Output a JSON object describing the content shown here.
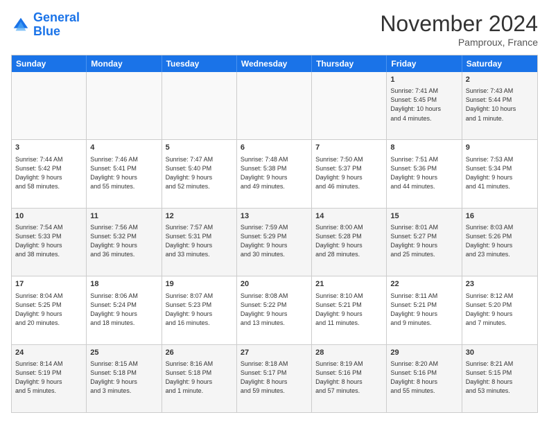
{
  "logo": {
    "line1": "General",
    "line2": "Blue"
  },
  "header": {
    "month": "November 2024",
    "location": "Pamproux, France"
  },
  "weekdays": [
    "Sunday",
    "Monday",
    "Tuesday",
    "Wednesday",
    "Thursday",
    "Friday",
    "Saturday"
  ],
  "rows": [
    [
      {
        "day": "",
        "info": "",
        "empty": true
      },
      {
        "day": "",
        "info": "",
        "empty": true
      },
      {
        "day": "",
        "info": "",
        "empty": true
      },
      {
        "day": "",
        "info": "",
        "empty": true
      },
      {
        "day": "",
        "info": "",
        "empty": true
      },
      {
        "day": "1",
        "info": "Sunrise: 7:41 AM\nSunset: 5:45 PM\nDaylight: 10 hours\nand 4 minutes.",
        "empty": false
      },
      {
        "day": "2",
        "info": "Sunrise: 7:43 AM\nSunset: 5:44 PM\nDaylight: 10 hours\nand 1 minute.",
        "empty": false
      }
    ],
    [
      {
        "day": "3",
        "info": "Sunrise: 7:44 AM\nSunset: 5:42 PM\nDaylight: 9 hours\nand 58 minutes.",
        "empty": false
      },
      {
        "day": "4",
        "info": "Sunrise: 7:46 AM\nSunset: 5:41 PM\nDaylight: 9 hours\nand 55 minutes.",
        "empty": false
      },
      {
        "day": "5",
        "info": "Sunrise: 7:47 AM\nSunset: 5:40 PM\nDaylight: 9 hours\nand 52 minutes.",
        "empty": false
      },
      {
        "day": "6",
        "info": "Sunrise: 7:48 AM\nSunset: 5:38 PM\nDaylight: 9 hours\nand 49 minutes.",
        "empty": false
      },
      {
        "day": "7",
        "info": "Sunrise: 7:50 AM\nSunset: 5:37 PM\nDaylight: 9 hours\nand 46 minutes.",
        "empty": false
      },
      {
        "day": "8",
        "info": "Sunrise: 7:51 AM\nSunset: 5:36 PM\nDaylight: 9 hours\nand 44 minutes.",
        "empty": false
      },
      {
        "day": "9",
        "info": "Sunrise: 7:53 AM\nSunset: 5:34 PM\nDaylight: 9 hours\nand 41 minutes.",
        "empty": false
      }
    ],
    [
      {
        "day": "10",
        "info": "Sunrise: 7:54 AM\nSunset: 5:33 PM\nDaylight: 9 hours\nand 38 minutes.",
        "empty": false
      },
      {
        "day": "11",
        "info": "Sunrise: 7:56 AM\nSunset: 5:32 PM\nDaylight: 9 hours\nand 36 minutes.",
        "empty": false
      },
      {
        "day": "12",
        "info": "Sunrise: 7:57 AM\nSunset: 5:31 PM\nDaylight: 9 hours\nand 33 minutes.",
        "empty": false
      },
      {
        "day": "13",
        "info": "Sunrise: 7:59 AM\nSunset: 5:29 PM\nDaylight: 9 hours\nand 30 minutes.",
        "empty": false
      },
      {
        "day": "14",
        "info": "Sunrise: 8:00 AM\nSunset: 5:28 PM\nDaylight: 9 hours\nand 28 minutes.",
        "empty": false
      },
      {
        "day": "15",
        "info": "Sunrise: 8:01 AM\nSunset: 5:27 PM\nDaylight: 9 hours\nand 25 minutes.",
        "empty": false
      },
      {
        "day": "16",
        "info": "Sunrise: 8:03 AM\nSunset: 5:26 PM\nDaylight: 9 hours\nand 23 minutes.",
        "empty": false
      }
    ],
    [
      {
        "day": "17",
        "info": "Sunrise: 8:04 AM\nSunset: 5:25 PM\nDaylight: 9 hours\nand 20 minutes.",
        "empty": false
      },
      {
        "day": "18",
        "info": "Sunrise: 8:06 AM\nSunset: 5:24 PM\nDaylight: 9 hours\nand 18 minutes.",
        "empty": false
      },
      {
        "day": "19",
        "info": "Sunrise: 8:07 AM\nSunset: 5:23 PM\nDaylight: 9 hours\nand 16 minutes.",
        "empty": false
      },
      {
        "day": "20",
        "info": "Sunrise: 8:08 AM\nSunset: 5:22 PM\nDaylight: 9 hours\nand 13 minutes.",
        "empty": false
      },
      {
        "day": "21",
        "info": "Sunrise: 8:10 AM\nSunset: 5:21 PM\nDaylight: 9 hours\nand 11 minutes.",
        "empty": false
      },
      {
        "day": "22",
        "info": "Sunrise: 8:11 AM\nSunset: 5:21 PM\nDaylight: 9 hours\nand 9 minutes.",
        "empty": false
      },
      {
        "day": "23",
        "info": "Sunrise: 8:12 AM\nSunset: 5:20 PM\nDaylight: 9 hours\nand 7 minutes.",
        "empty": false
      }
    ],
    [
      {
        "day": "24",
        "info": "Sunrise: 8:14 AM\nSunset: 5:19 PM\nDaylight: 9 hours\nand 5 minutes.",
        "empty": false
      },
      {
        "day": "25",
        "info": "Sunrise: 8:15 AM\nSunset: 5:18 PM\nDaylight: 9 hours\nand 3 minutes.",
        "empty": false
      },
      {
        "day": "26",
        "info": "Sunrise: 8:16 AM\nSunset: 5:18 PM\nDaylight: 9 hours\nand 1 minute.",
        "empty": false
      },
      {
        "day": "27",
        "info": "Sunrise: 8:18 AM\nSunset: 5:17 PM\nDaylight: 8 hours\nand 59 minutes.",
        "empty": false
      },
      {
        "day": "28",
        "info": "Sunrise: 8:19 AM\nSunset: 5:16 PM\nDaylight: 8 hours\nand 57 minutes.",
        "empty": false
      },
      {
        "day": "29",
        "info": "Sunrise: 8:20 AM\nSunset: 5:16 PM\nDaylight: 8 hours\nand 55 minutes.",
        "empty": false
      },
      {
        "day": "30",
        "info": "Sunrise: 8:21 AM\nSunset: 5:15 PM\nDaylight: 8 hours\nand 53 minutes.",
        "empty": false
      }
    ]
  ]
}
